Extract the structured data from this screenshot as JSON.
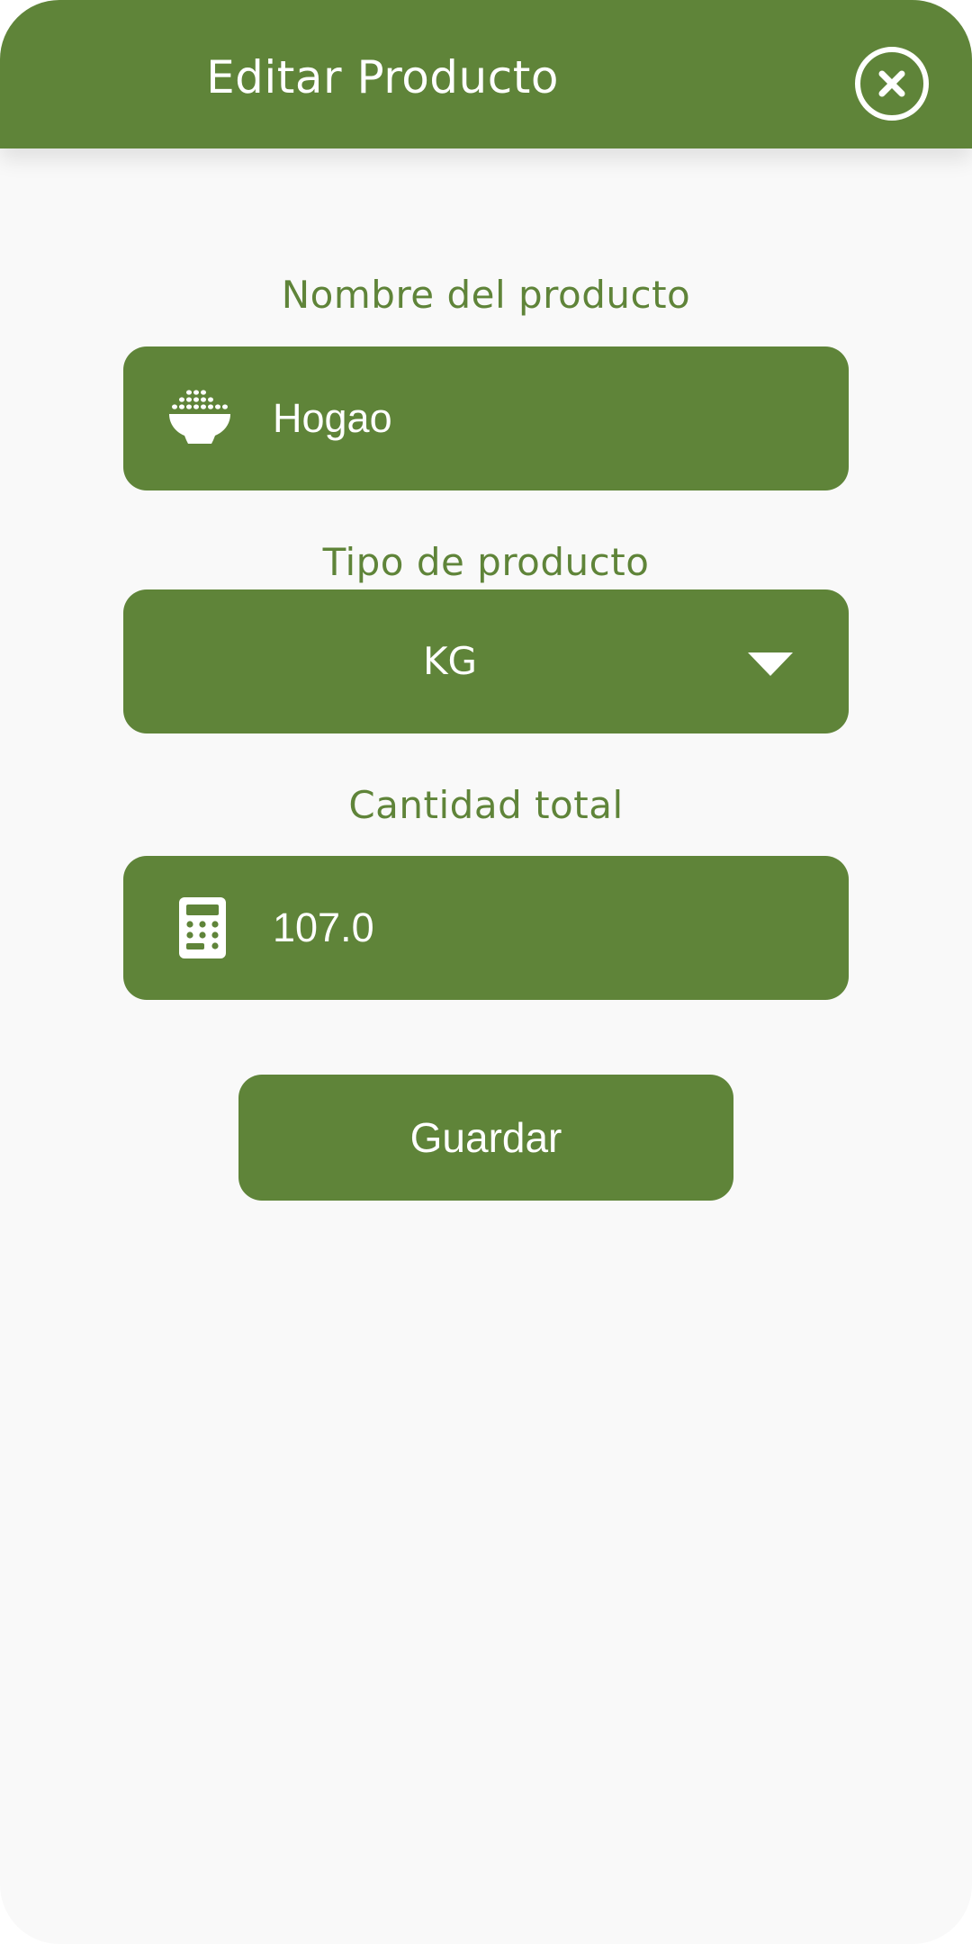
{
  "header": {
    "title": "Editar Producto",
    "close_icon": "close-circle-icon"
  },
  "form": {
    "name_label": "Nombre del producto",
    "name_value": "Hogao",
    "name_icon": "rice-bowl-icon",
    "type_label": "Tipo de producto",
    "type_value": "KG",
    "type_icon": "dropdown-arrow-icon",
    "quantity_label": "Cantidad total",
    "quantity_value": "107.0",
    "quantity_icon": "calculator-icon",
    "save_label": "Guardar"
  },
  "colors": {
    "primary": "#5f8439",
    "background": "#f9f9f9",
    "text_on_primary": "#ffffff"
  }
}
